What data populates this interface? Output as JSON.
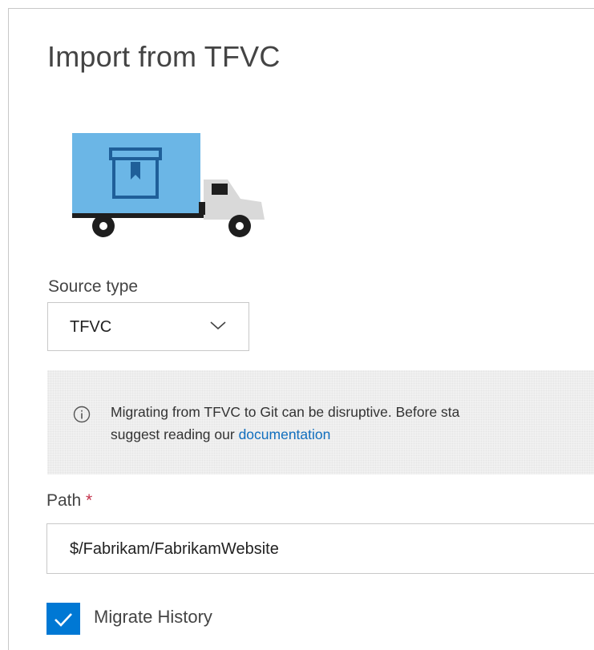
{
  "dialog": {
    "title": "Import from TFVC"
  },
  "illustration": {
    "icon": "moving-truck-icon",
    "colors": {
      "cargo": "#6bb6e6",
      "cab": "#d8d8d8",
      "dark": "#1e1e1e"
    }
  },
  "source_type": {
    "label": "Source type",
    "selected": "TFVC"
  },
  "info_message": {
    "icon": "info-icon",
    "line1": "Migrating from TFVC to Git can be disruptive. Before sta",
    "line2_prefix": "suggest reading our ",
    "link_text": "documentation"
  },
  "path": {
    "label": "Path",
    "required_marker": "*",
    "value": "$/Fabrikam/FabrikamWebsite"
  },
  "migrate_history": {
    "label": "Migrate History",
    "checked": true,
    "accent": "#0078d4"
  }
}
